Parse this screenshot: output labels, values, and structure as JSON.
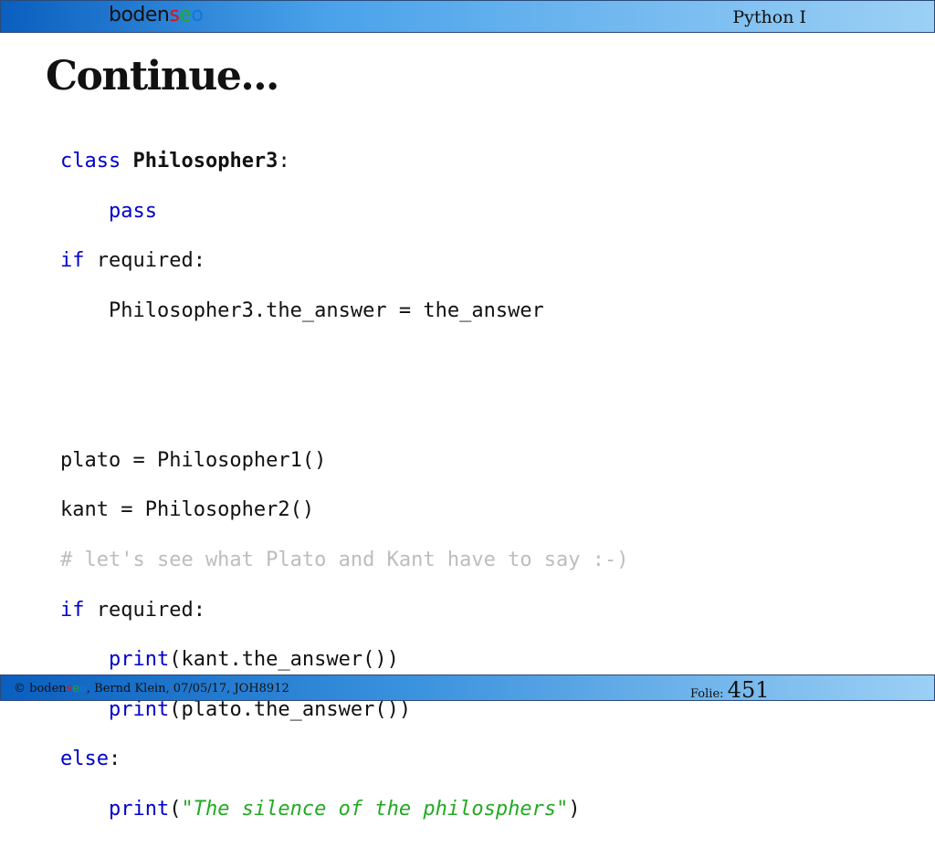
{
  "header": {
    "logo": {
      "p1": "boden",
      "p2": "s",
      "p3": "e",
      "p4": "o"
    },
    "course": "Python I"
  },
  "slide": {
    "title": "Continue..."
  },
  "code": {
    "l1": {
      "kw": "class",
      "sp": " ",
      "name": "Philosopher3",
      "colon": ":"
    },
    "l2": {
      "indent": "    ",
      "kw": "pass"
    },
    "l3": {
      "kw": "if",
      "rest": " required:"
    },
    "l4": {
      "text": "    Philosopher3.the_answer = the_answer"
    },
    "l7": {
      "text": "plato = Philosopher1()"
    },
    "l8": {
      "text": "kant = Philosopher2()"
    },
    "l9": {
      "comment": "# let's see what Plato and Kant have to say :-)"
    },
    "l10": {
      "kw": "if",
      "rest": " required:"
    },
    "l11": {
      "indent": "    ",
      "kw": "print",
      "rest": "(kant.the_answer())"
    },
    "l12": {
      "indent": "    ",
      "kw": "print",
      "rest": "(plato.the_answer())"
    },
    "l13": {
      "kw": "else",
      "rest": ":"
    },
    "l14": {
      "indent": "    ",
      "kw": "print",
      "open": "(",
      "q1": "\"",
      "str": "The silence of the philosphers",
      "q2": "\"",
      "close": ")"
    }
  },
  "footer": {
    "copy": "© ",
    "logo": {
      "p1": "boden",
      "p2": "s",
      "p3": "e",
      "p4": "o"
    },
    "info": ", Bernd Klein, 07/05/17, JOH8912",
    "folie_label": "Folie: ",
    "folie_number": "451"
  }
}
